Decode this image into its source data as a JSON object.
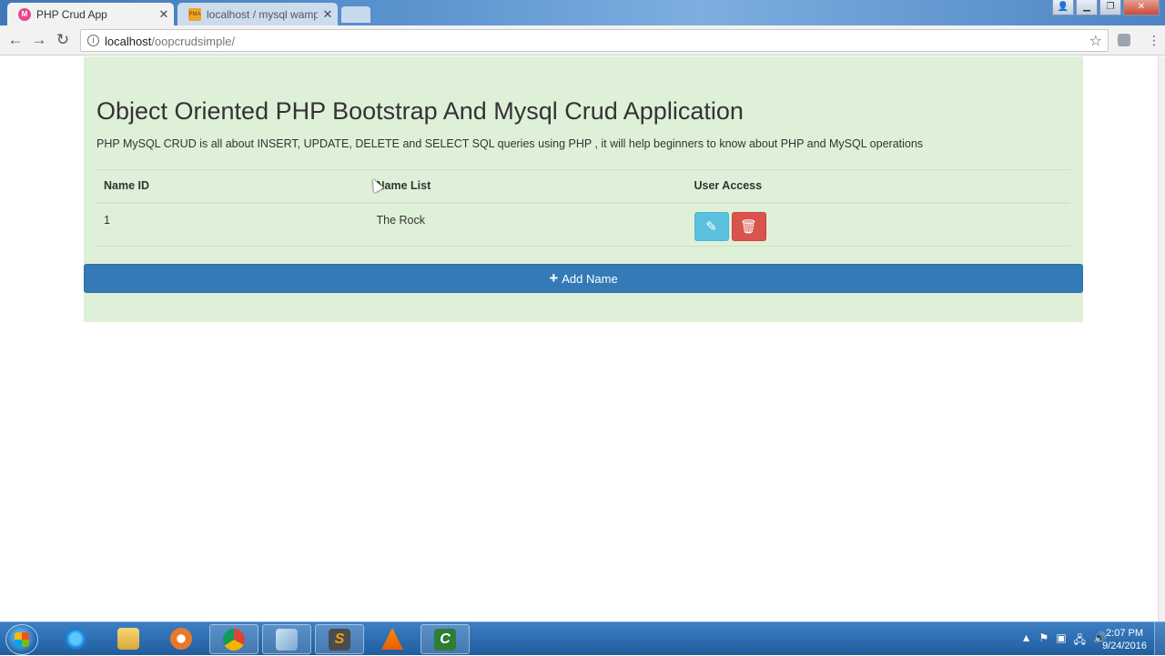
{
  "browser": {
    "tabs": [
      {
        "title": "PHP Crud App",
        "favicon": "php-crud-favicon-icon",
        "active": true
      },
      {
        "title": "localhost / mysql wamps",
        "favicon": "phpmyadmin-favicon-icon",
        "active": false
      }
    ],
    "url": {
      "host": "localhost",
      "path": "/oopcrudsimple/"
    }
  },
  "page": {
    "title": "Object Oriented PHP Bootstrap And Mysql Crud Application",
    "description": "PHP MySQL CRUD is all about INSERT, UPDATE, DELETE and SELECT SQL queries using PHP , it will help beginners to know about PHP and MySQL operations",
    "table": {
      "headers": [
        "Name ID",
        "Name List",
        "User Access"
      ],
      "rows": [
        {
          "id": "1",
          "name": "The Rock"
        }
      ]
    },
    "add_button_label": "Add Name",
    "colors": {
      "panel": "#dff0d8",
      "primary": "#337ab7",
      "info": "#5bc0de",
      "danger": "#d9534f"
    }
  },
  "taskbar": {
    "clock_time": "2:07 PM",
    "clock_date": "9/24/2016"
  }
}
